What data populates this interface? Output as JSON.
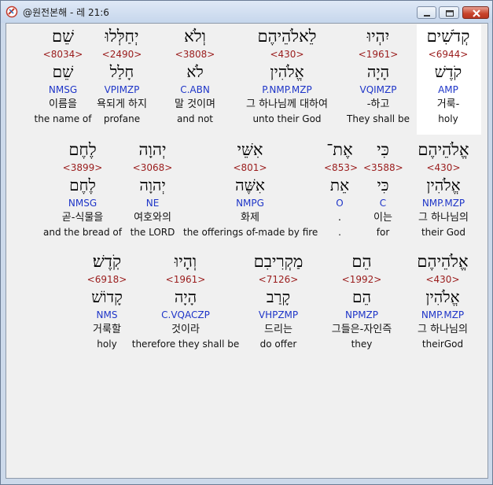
{
  "window": {
    "title": "@원전본해 - 레 21:6",
    "buttons": [
      "minimize",
      "maximize",
      "close"
    ]
  },
  "rows": [
    {
      "words": [
        {
          "hebrew": "קְדֹשִׁים",
          "strong": "<6944>",
          "lemma": "קֹדֶשׁ",
          "parse": "AMP",
          "korean": "거룩-",
          "english": "holy",
          "highlighted": true
        },
        {
          "hebrew": "יִהְיוּ",
          "strong": "<1961>",
          "lemma": "הָיָה",
          "parse": "VQIMZP",
          "korean": "-하고",
          "english": "They shall be"
        },
        {
          "hebrew": "לֵאלֹהֵיהֶם",
          "strong": "<430>",
          "lemma": "אֱלֹהִין",
          "parse": "P.NMP.MZP",
          "korean": "그 하나님께 대하여",
          "english": "unto their God"
        },
        {
          "hebrew": "וְלֹא",
          "strong": "<3808>",
          "lemma": "לֹא",
          "parse": "C.ABN",
          "korean": "말 것이며",
          "english": "and not"
        },
        {
          "hebrew": "יְחַלְּלוּ",
          "strong": "<2490>",
          "lemma": "חָלַל",
          "parse": "VPIMZP",
          "korean": "욕되게 하지",
          "english": "profane"
        },
        {
          "hebrew": "שֵׁם",
          "strong": "<8034>",
          "lemma": "שֵׁם",
          "parse": "NMSG",
          "korean": "이름을",
          "english": "the name of"
        }
      ]
    },
    {
      "words": [
        {
          "hebrew": "אֱלֹהֵיהֶם",
          "strong": "<430>",
          "lemma": "אֱלֹהִין",
          "parse": "NMP.MZP",
          "korean": "그 하나님의",
          "english": "their God"
        },
        {
          "hebrew": "כִּי",
          "strong": "<3588>",
          "lemma": "כִּי",
          "parse": "C",
          "korean": "이는",
          "english": "for"
        },
        {
          "hebrew": "אֶת־",
          "strong": "<853>",
          "lemma": "אֵת",
          "parse": "O",
          "korean": ".",
          "english": "."
        },
        {
          "hebrew": "אִשֵּׁי",
          "strong": "<801>",
          "lemma": "אִשֶּׁה",
          "parse": "NMPG",
          "korean": "화제",
          "english": "the offerings of-made by fire"
        },
        {
          "hebrew": "יְהוָה",
          "strong": "<3068>",
          "lemma": "יְהוָה",
          "parse": "NE",
          "korean": "여호와의",
          "english": "the LORD"
        },
        {
          "hebrew": "לֶחֶם",
          "strong": "<3899>",
          "lemma": "לֶחֶם",
          "parse": "NMSG",
          "korean": "곧-식물을",
          "english": "and the bread of"
        }
      ]
    },
    {
      "words": [
        {
          "hebrew": "אֱלֹהֵיהֶם",
          "strong": "<430>",
          "lemma": "אֱלֹהִין",
          "parse": "NMP.MZP",
          "korean": "그 하나님의",
          "english": "theirGod"
        },
        {
          "hebrew": "הֵם",
          "strong": "<1992>",
          "lemma": "הֵם",
          "parse": "NPMZP",
          "korean": "그들은-자인즉",
          "english": "they"
        },
        {
          "hebrew": "מַקְרִיבִם",
          "strong": "<7126>",
          "lemma": "קָרַב",
          "parse": "VHPZMP",
          "korean": "드리는",
          "english": "do offer"
        },
        {
          "hebrew": "וְהָיוּ",
          "strong": "<1961>",
          "lemma": "הָיָה",
          "parse": "C.VQACZP",
          "korean": "것이라",
          "english": "therefore they shall be"
        },
        {
          "hebrew": "קֹֽדֶשׁ׃",
          "strong": "<6918>",
          "lemma": "קָדוֹשׁ",
          "parse": "NMS",
          "korean": "거룩할",
          "english": "holy"
        }
      ]
    }
  ]
}
